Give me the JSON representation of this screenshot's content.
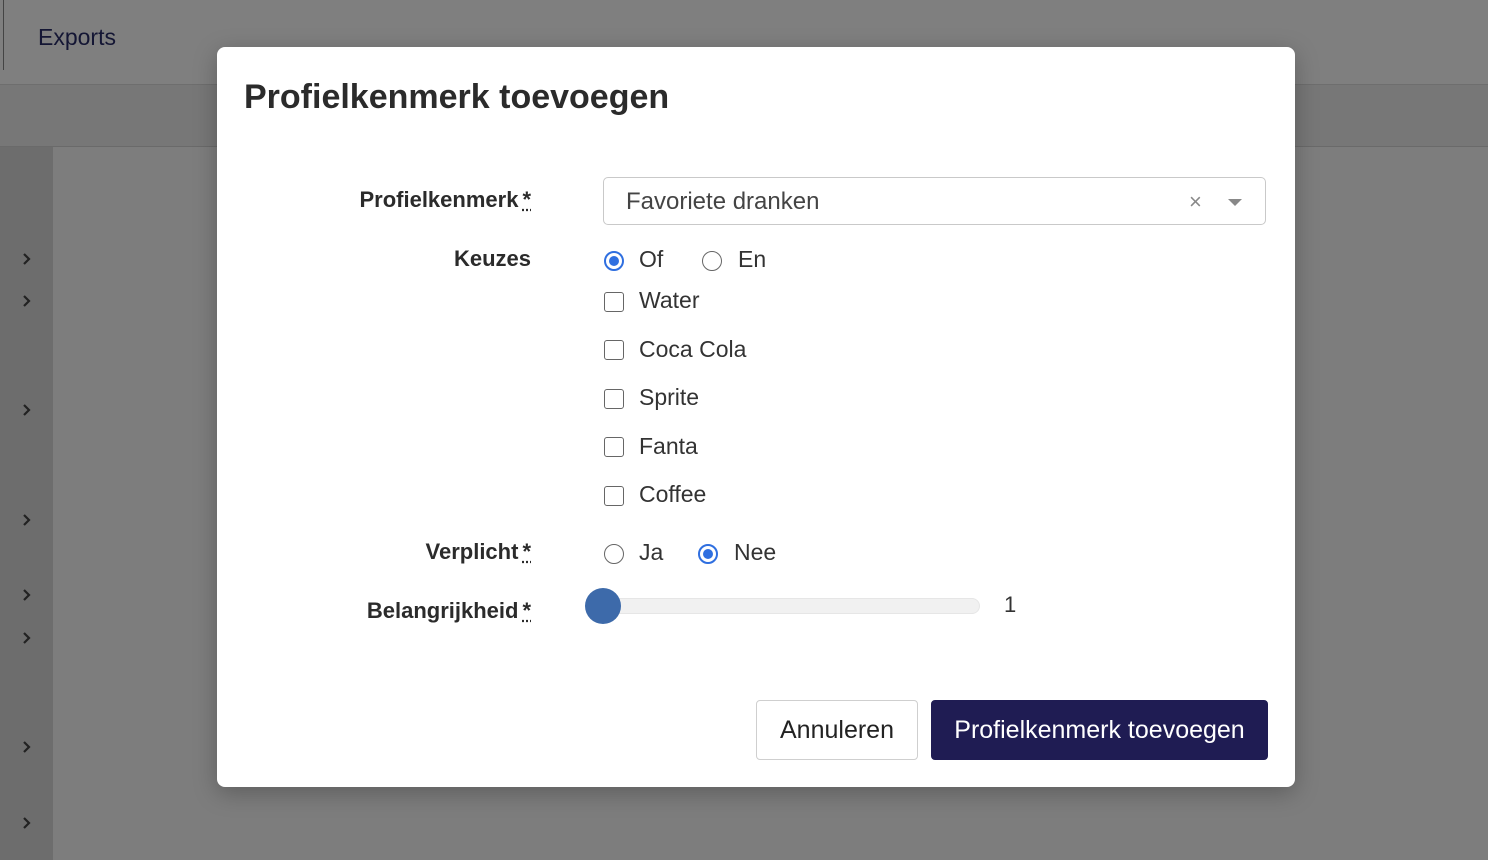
{
  "background": {
    "tab_label": "Exports",
    "sidebar_chevrons": [
      "chevron-right-icon",
      "chevron-right-icon",
      "chevron-right-icon",
      "chevron-right-icon",
      "chevron-right-icon",
      "chevron-right-icon",
      "chevron-right-icon",
      "chevron-right-icon"
    ]
  },
  "modal": {
    "title": "Profielkenmerk toevoegen",
    "fields": {
      "profielkenmerk": {
        "label": "Profielkenmerk",
        "required_mark": "*",
        "value": "Favoriete dranken",
        "clear_glyph": "×"
      },
      "keuzes": {
        "label": "Keuzes",
        "mode_options": [
          {
            "label": "Of",
            "selected": true
          },
          {
            "label": "En",
            "selected": false
          }
        ],
        "choices": [
          {
            "label": "Water",
            "checked": false
          },
          {
            "label": "Coca Cola",
            "checked": false
          },
          {
            "label": "Sprite",
            "checked": false
          },
          {
            "label": "Fanta",
            "checked": false
          },
          {
            "label": "Coffee",
            "checked": false
          }
        ]
      },
      "verplicht": {
        "label": "Verplicht",
        "required_mark": "*",
        "options": [
          {
            "label": "Ja",
            "selected": false
          },
          {
            "label": "Nee",
            "selected": true
          }
        ]
      },
      "belangrijkheid": {
        "label": "Belangrijkheid",
        "required_mark": "*",
        "value": "1",
        "fill_fraction": 0
      }
    },
    "buttons": {
      "cancel": "Annuleren",
      "submit": "Profielkenmerk toevoegen"
    }
  },
  "colors": {
    "accent": "#2f6fe0",
    "primary_button": "#1f1c53",
    "slider_thumb": "#3d6aaa",
    "overlay": "#7d7d7d"
  }
}
